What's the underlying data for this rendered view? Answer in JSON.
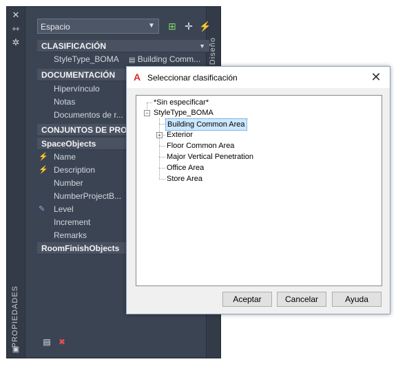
{
  "palette": {
    "side_label": "PROPIEDADES",
    "right_tab": "Diseño",
    "object_type": "Espacio",
    "sections": {
      "clasificacion": "CLASIFICACIÓN",
      "documentacion": "DOCUMENTACIÓN",
      "conjuntos": "CONJUNTOS DE PROP",
      "space_objects": "SpaceObjects",
      "room_finish": "RoomFinishObjects"
    },
    "style_row": {
      "label": "StyleType_BOMA",
      "value": "Building Comm..."
    },
    "doc_rows": [
      "Hipervínculo",
      "Notas",
      "Documentos de r..."
    ],
    "space_rows": [
      "Name",
      "Description",
      "Number",
      "NumberProjectB...",
      "Level",
      "Increment",
      "Remarks"
    ]
  },
  "dialog": {
    "title": "Seleccionar clasificación",
    "tree": {
      "unspecified": "*Sin especificar*",
      "root": "StyleType_BOMA",
      "children": [
        "Building Common Area",
        "Exterior",
        "Floor Common Area",
        "Major Vertical Penetration",
        "Office Area",
        "Store Area"
      ]
    },
    "buttons": {
      "ok": "Aceptar",
      "cancel": "Cancelar",
      "help": "Ayuda"
    }
  },
  "colors": {
    "palette_bg": "#3b4453",
    "selection": "#cce8ff",
    "accent_red": "#d92b2b"
  },
  "icons": [
    "close-icon",
    "pin-icon",
    "settings-icon",
    "add-object-icon",
    "select-objects-icon",
    "quick-select-icon",
    "dropdown-arrow-icon"
  ]
}
